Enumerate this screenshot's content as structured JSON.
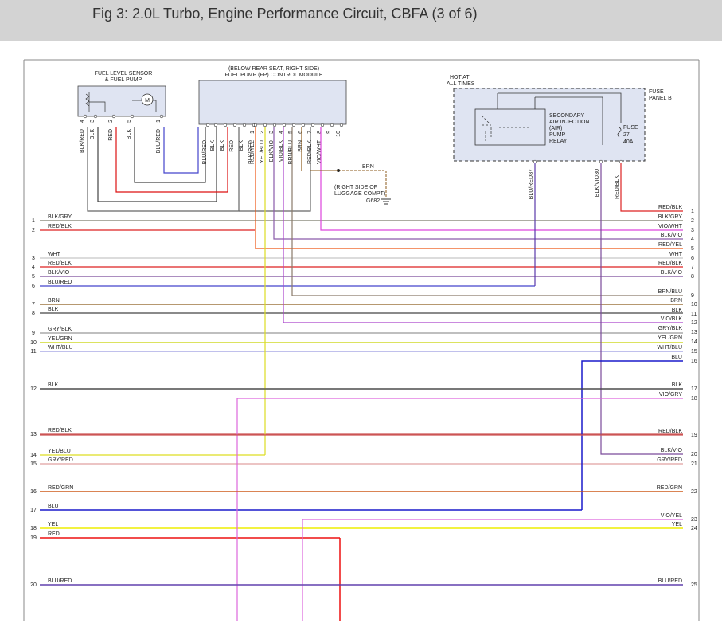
{
  "title": "Fig 3: 2.0L Turbo, Engine Performance Circuit, CBFA (3 of 6)",
  "components": {
    "fuel_sensor": [
      "FUEL LEVEL SENSOR",
      "& FUEL PUMP"
    ],
    "fuel_sensor_motor": "M",
    "fp_module": [
      "(BELOW REAR SEAT, RIGHT SIDE)",
      "FUEL PUMP (FP) CONTROL MODULE"
    ],
    "hot_at": [
      "HOT AT",
      "ALL TIMES"
    ],
    "fuse_panel": [
      "FUSE",
      "PANEL B"
    ],
    "relay": [
      "SECONDARY",
      "AIR INJECTION",
      "(AIR)",
      "PUMP",
      "RELAY"
    ],
    "fuse": [
      "FUSE",
      "27",
      "40A"
    ],
    "ground": [
      "(RIGHT SIDE OF",
      "LUGGAGE COMPT)",
      "G682"
    ],
    "brn_label": "BRN"
  },
  "sensor_pins": [
    {
      "pin": "4",
      "wire": "BLK/RED"
    },
    {
      "pin": "3",
      "wire": "BLK"
    },
    {
      "pin": "2",
      "wire": "RED"
    },
    {
      "pin": "5",
      "wire": "BLK"
    },
    {
      "pin": "1",
      "wire": "BLU/RED"
    }
  ],
  "module_pins_left": [
    "BLU/RED",
    "BLK",
    "BLK",
    "RED",
    "BLK",
    "BLK/RED"
  ],
  "module_pins_right": [
    {
      "pin": "1",
      "wire": "RED/YEL"
    },
    {
      "pin": "2",
      "wire": "YEL/BLU"
    },
    {
      "pin": "3",
      "wire": "BLK/VIO"
    },
    {
      "pin": "4",
      "wire": "VIO/BLK"
    },
    {
      "pin": "5",
      "wire": "BRN/BLU"
    },
    {
      "pin": "6",
      "wire": "BRN"
    },
    {
      "pin": "7",
      "wire": "RED/BLK"
    },
    {
      "pin": "8",
      "wire": "VIO/WHT"
    },
    {
      "pin": "9",
      "wire": ""
    },
    {
      "pin": "10",
      "wire": ""
    }
  ],
  "relay_pins": [
    {
      "pin": "87",
      "wire": "BLU/RED"
    },
    {
      "pin": "30",
      "wire": "BLK/VIO"
    },
    {
      "pin": "",
      "wire": "RED/BLK"
    }
  ],
  "left_rows": [
    {
      "n": "1",
      "label": "BLK/GRY",
      "color": "#7a7a6a"
    },
    {
      "n": "2",
      "label": "RED/BLK",
      "color": "#dd2222"
    },
    {
      "n": "3",
      "label": "WHT",
      "color": "#c8c8c8"
    },
    {
      "n": "4",
      "label": "RED/BLK",
      "color": "#dd2222"
    },
    {
      "n": "5",
      "label": "BLK/VIO",
      "color": "#7a4a9a"
    },
    {
      "n": "6",
      "label": "BLU/RED",
      "color": "#4444cc"
    },
    {
      "n": "7",
      "label": "BRN",
      "color": "#8b5a1b"
    },
    {
      "n": "8",
      "label": "BLK",
      "color": "#444444"
    },
    {
      "n": "9",
      "label": "GRY/BLK",
      "color": "#999999"
    },
    {
      "n": "10",
      "label": "YEL/GRN",
      "color": "#c8d200"
    },
    {
      "n": "11",
      "label": "WHT/BLU",
      "color": "#9a9ae0"
    },
    {
      "n": "12",
      "label": "BLK",
      "color": "#444444"
    },
    {
      "n": "13",
      "label": "RED/BLK",
      "color": "#cc5555"
    },
    {
      "n": "14",
      "label": "YEL/BLU",
      "color": "#dddd22"
    },
    {
      "n": "15",
      "label": "GRY/RED",
      "color": "#e0a0a0"
    },
    {
      "n": "16",
      "label": "RED/GRN",
      "color": "#cc5511"
    },
    {
      "n": "17",
      "label": "BLU",
      "color": "#1a1acc"
    },
    {
      "n": "18",
      "label": "YEL",
      "color": "#eeee00"
    },
    {
      "n": "19",
      "label": "RED",
      "color": "#ee1111"
    },
    {
      "n": "20",
      "label": "BLU/RED",
      "color": "#5a3aaa"
    }
  ],
  "right_rows": [
    {
      "n": "1",
      "label": "RED/BLK",
      "color": "#dd2222"
    },
    {
      "n": "2",
      "label": "BLK/GRY",
      "color": "#7a7a6a"
    },
    {
      "n": "3",
      "label": "VIO/WHT",
      "color": "#dd44dd"
    },
    {
      "n": "4",
      "label": "BLK/VIO",
      "color": "#8a5aaa"
    },
    {
      "n": "5",
      "label": "RED/YEL",
      "color": "#ee5511"
    },
    {
      "n": "6",
      "label": "WHT",
      "color": "#c8c8c8"
    },
    {
      "n": "7",
      "label": "RED/BLK",
      "color": "#dd2222"
    },
    {
      "n": "8",
      "label": "BLK/VIO",
      "color": "#7a4a9a"
    },
    {
      "n": "9",
      "label": "BRN/BLU",
      "color": "#8a7a6a"
    },
    {
      "n": "10",
      "label": "BRN",
      "color": "#8b5a1b"
    },
    {
      "n": "11",
      "label": "BLK",
      "color": "#444444"
    },
    {
      "n": "12",
      "label": "VIO/BLK",
      "color": "#aa44cc"
    },
    {
      "n": "13",
      "label": "GRY/BLK",
      "color": "#999999"
    },
    {
      "n": "14",
      "label": "YEL/GRN",
      "color": "#c8d200"
    },
    {
      "n": "15",
      "label": "WHT/BLU",
      "color": "#9a9ae0"
    },
    {
      "n": "16",
      "label": "BLU",
      "color": "#1a1acc"
    },
    {
      "n": "17",
      "label": "BLK",
      "color": "#444444"
    },
    {
      "n": "18",
      "label": "VIO/GRY",
      "color": "#dd66dd"
    },
    {
      "n": "19",
      "label": "RED/BLK",
      "color": "#cc5555"
    },
    {
      "n": "20",
      "label": "BLK/VIO",
      "color": "#7a4a9a"
    },
    {
      "n": "21",
      "label": "GRY/RED",
      "color": "#e0a0a0"
    },
    {
      "n": "22",
      "label": "RED/GRN",
      "color": "#cc5511"
    },
    {
      "n": "23",
      "label": "VIO/YEL",
      "color": "#dd66dd"
    },
    {
      "n": "24",
      "label": "YEL",
      "color": "#eeee00"
    },
    {
      "n": "25",
      "label": "BLU/RED",
      "color": "#5a3aaa"
    }
  ]
}
